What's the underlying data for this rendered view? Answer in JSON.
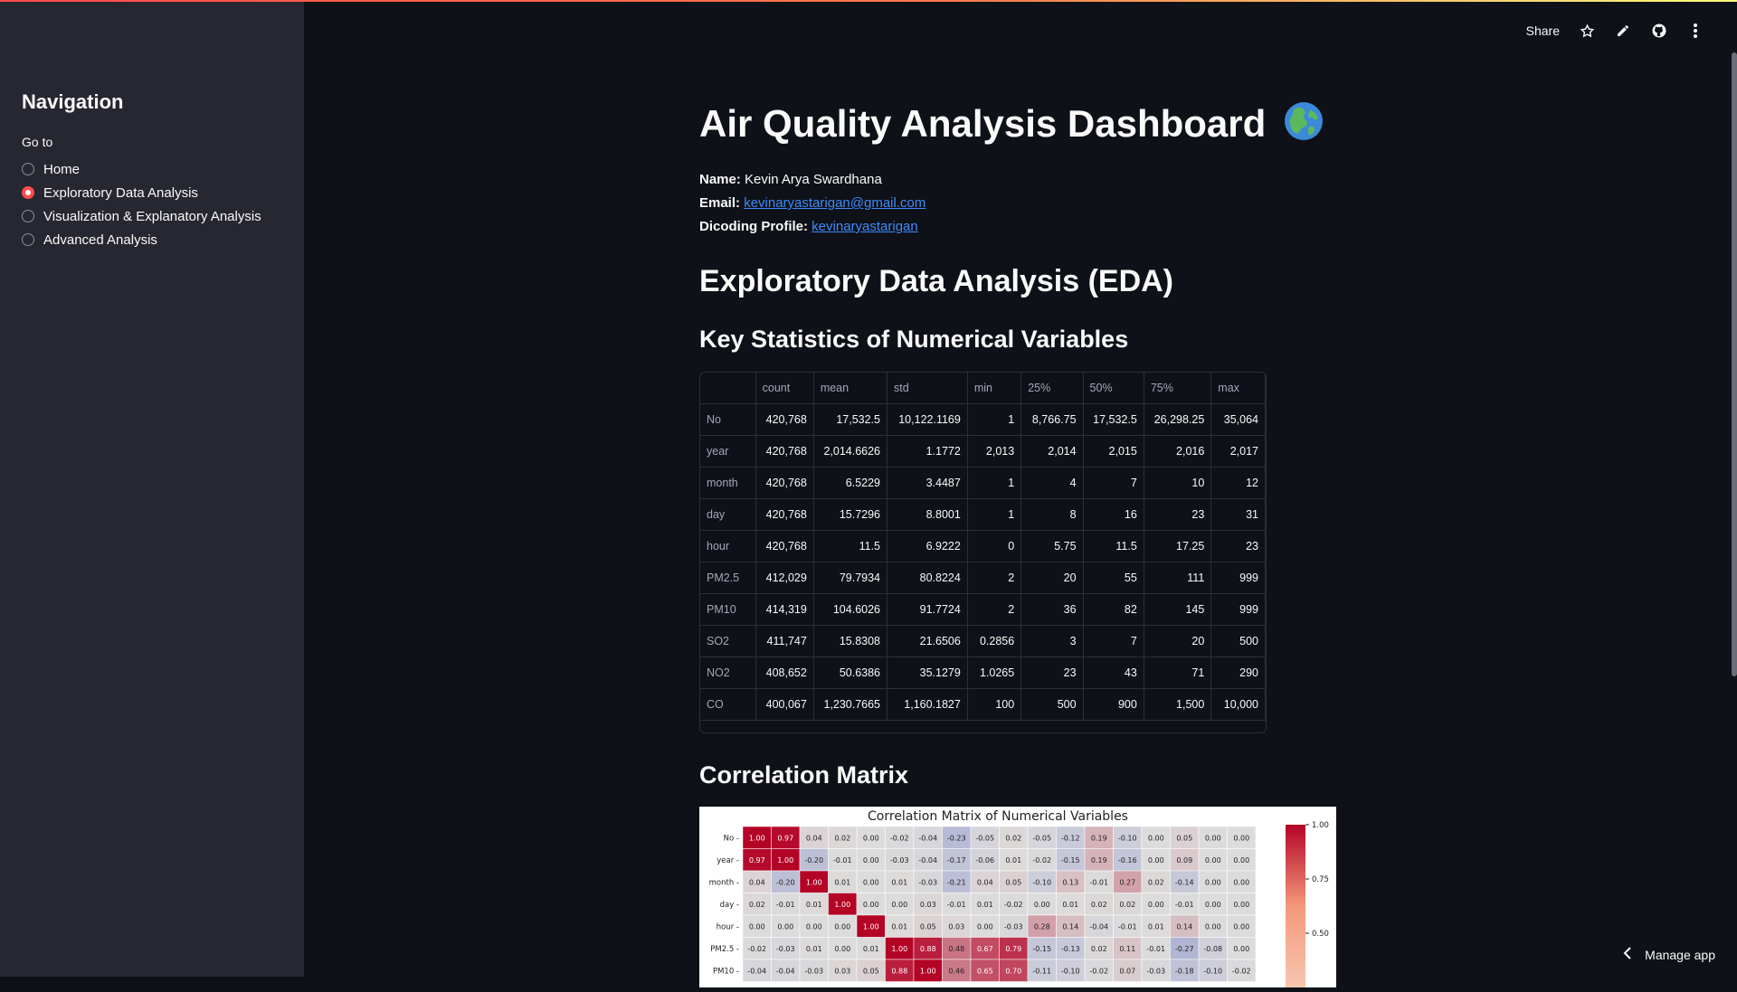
{
  "sidebar": {
    "title": "Navigation",
    "goto_label": "Go to",
    "options": [
      "Home",
      "Exploratory Data Analysis",
      "Visualization & Explanatory Analysis",
      "Advanced Analysis"
    ],
    "selected_index": 1
  },
  "header": {
    "share_label": "Share",
    "icons": [
      "star-icon",
      "edit-icon",
      "github-icon",
      "more-vertical-icon"
    ]
  },
  "main": {
    "title": "Air Quality Analysis Dashboard",
    "name_label": "Name:",
    "name_value": "Kevin Arya Swardhana",
    "email_label": "Email:",
    "email_value": "kevinaryastarigan@gmail.com",
    "profile_label": "Dicoding Profile:",
    "profile_value": "kevinaryastarigan",
    "eda_heading": "Exploratory Data Analysis (EDA)",
    "stats_heading": "Key Statistics of Numerical Variables",
    "corr_heading": "Correlation Matrix"
  },
  "stats_table": {
    "columns": [
      "",
      "count",
      "mean",
      "std",
      "min",
      "25%",
      "50%",
      "75%",
      "max"
    ],
    "rows": [
      [
        "No",
        "420,768",
        "17,532.5",
        "10,122.1169",
        "1",
        "8,766.75",
        "17,532.5",
        "26,298.25",
        "35,064"
      ],
      [
        "year",
        "420,768",
        "2,014.6626",
        "1.1772",
        "2,013",
        "2,014",
        "2,015",
        "2,016",
        "2,017"
      ],
      [
        "month",
        "420,768",
        "6.5229",
        "3.4487",
        "1",
        "4",
        "7",
        "10",
        "12"
      ],
      [
        "day",
        "420,768",
        "15.7296",
        "8.8001",
        "1",
        "8",
        "16",
        "23",
        "31"
      ],
      [
        "hour",
        "420,768",
        "11.5",
        "6.9222",
        "0",
        "5.75",
        "11.5",
        "17.25",
        "23"
      ],
      [
        "PM2.5",
        "412,029",
        "79.7934",
        "80.8224",
        "2",
        "20",
        "55",
        "111",
        "999"
      ],
      [
        "PM10",
        "414,319",
        "104.6026",
        "91.7724",
        "2",
        "36",
        "82",
        "145",
        "999"
      ],
      [
        "SO2",
        "411,747",
        "15.8308",
        "21.6506",
        "0.2856",
        "3",
        "7",
        "20",
        "500"
      ],
      [
        "NO2",
        "408,652",
        "50.6386",
        "35.1279",
        "1.0265",
        "23",
        "43",
        "71",
        "290"
      ],
      [
        "CO",
        "400,067",
        "1,230.7665",
        "1,160.1827",
        "100",
        "500",
        "900",
        "1,500",
        "10,000"
      ]
    ]
  },
  "chart_data": {
    "type": "heatmap",
    "title": "Correlation Matrix of Numerical Variables",
    "rows": [
      "No",
      "year",
      "month",
      "day",
      "hour",
      "PM2.5",
      "PM10"
    ],
    "values": [
      [
        1.0,
        0.97,
        0.04,
        0.02,
        0.0,
        -0.02,
        -0.04,
        -0.23,
        -0.05,
        0.02,
        -0.05,
        -0.12,
        0.19,
        -0.1,
        0.0,
        0.05,
        0.0,
        -0.0
      ],
      [
        0.97,
        1.0,
        -0.2,
        -0.01,
        -0.0,
        -0.03,
        -0.04,
        -0.17,
        -0.06,
        0.01,
        -0.02,
        -0.15,
        0.19,
        -0.16,
        0.0,
        0.09,
        0.0,
        -0.0
      ],
      [
        0.04,
        -0.2,
        1.0,
        0.01,
        -0.0,
        0.01,
        -0.03,
        -0.21,
        0.04,
        0.05,
        -0.1,
        0.13,
        -0.01,
        0.27,
        0.02,
        -0.14,
        -0.0,
        -0.0
      ],
      [
        0.02,
        -0.01,
        0.01,
        1.0,
        0.0,
        0.0,
        0.03,
        -0.01,
        0.01,
        -0.02,
        0.0,
        0.01,
        0.02,
        0.02,
        -0.0,
        -0.01,
        -0.0,
        0.0
      ],
      [
        0.0,
        -0.0,
        -0.0,
        0.0,
        1.0,
        0.01,
        0.05,
        0.03,
        -0.0,
        -0.03,
        0.28,
        0.14,
        -0.04,
        -0.01,
        0.01,
        0.14,
        0.0,
        0.0
      ],
      [
        -0.02,
        -0.03,
        0.01,
        0.0,
        0.01,
        1.0,
        0.88,
        0.48,
        0.67,
        0.79,
        -0.15,
        -0.13,
        0.02,
        0.11,
        -0.01,
        -0.27,
        -0.08,
        0.0
      ],
      [
        -0.04,
        -0.04,
        -0.03,
        0.03,
        0.05,
        0.88,
        1.0,
        0.46,
        0.65,
        0.7,
        -0.11,
        -0.1,
        -0.02,
        0.07,
        -0.03,
        -0.18,
        -0.1,
        -0.02
      ]
    ],
    "colorbar_ticks": [
      "1.00",
      "0.75",
      "0.50"
    ],
    "colors": {
      "high": "#b40426",
      "mid": "#dddcdc",
      "low": "#3b4cc0"
    }
  },
  "footer": {
    "manage_label": "Manage app"
  }
}
